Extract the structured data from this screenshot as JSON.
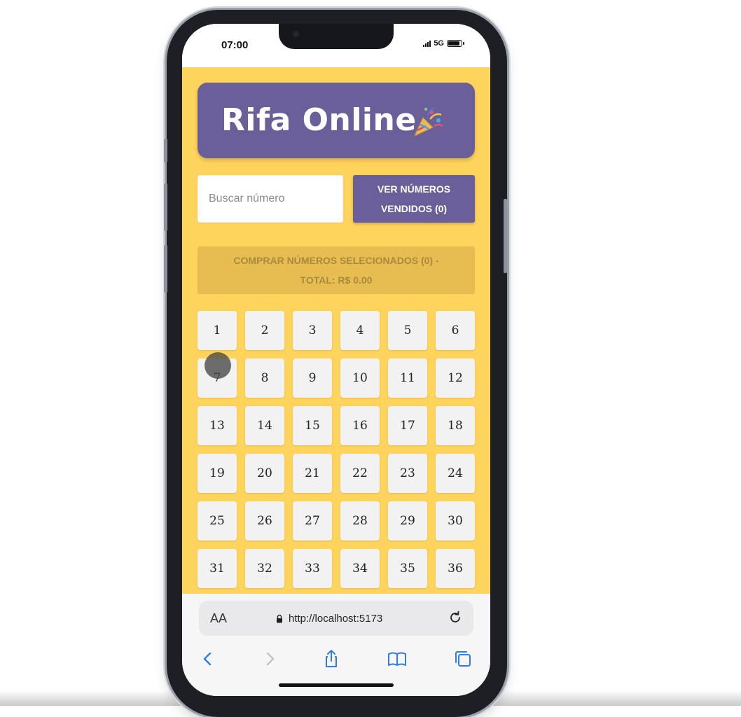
{
  "status_bar": {
    "time": "07:00",
    "network": "5G",
    "icons": [
      "signal-icon",
      "battery-icon"
    ]
  },
  "header": {
    "title": "Rifa Online",
    "emoji_icon": "party-popper-icon",
    "color": "#6a5f99"
  },
  "search": {
    "placeholder": "Buscar número",
    "value": ""
  },
  "vendidos_button": {
    "label": "VER NÚMEROS VENDIDOS (0)"
  },
  "buy_button": {
    "label": "COMPRAR NÚMEROS SELECIONADOS (0) - TOTAL: R$ 0.00",
    "state": "disabled"
  },
  "numbers": [
    "1",
    "2",
    "3",
    "4",
    "5",
    "6",
    "7",
    "8",
    "9",
    "10",
    "11",
    "12",
    "13",
    "14",
    "15",
    "16",
    "17",
    "18",
    "19",
    "20",
    "21",
    "22",
    "23",
    "24",
    "25",
    "26",
    "27",
    "28",
    "29",
    "30",
    "31",
    "32",
    "33",
    "34",
    "35",
    "36"
  ],
  "browser": {
    "text_size_label": "AA",
    "url": "http://localhost:5173",
    "icons": [
      "reload-icon",
      "back-icon",
      "forward-icon",
      "share-icon",
      "bookmarks-icon",
      "tabs-icon",
      "lock-icon"
    ]
  },
  "colors": {
    "background": "#ffd45c",
    "accent": "#6a5f99",
    "buy_disabled": "#e7bd51",
    "tile": "#f2f2f2"
  }
}
